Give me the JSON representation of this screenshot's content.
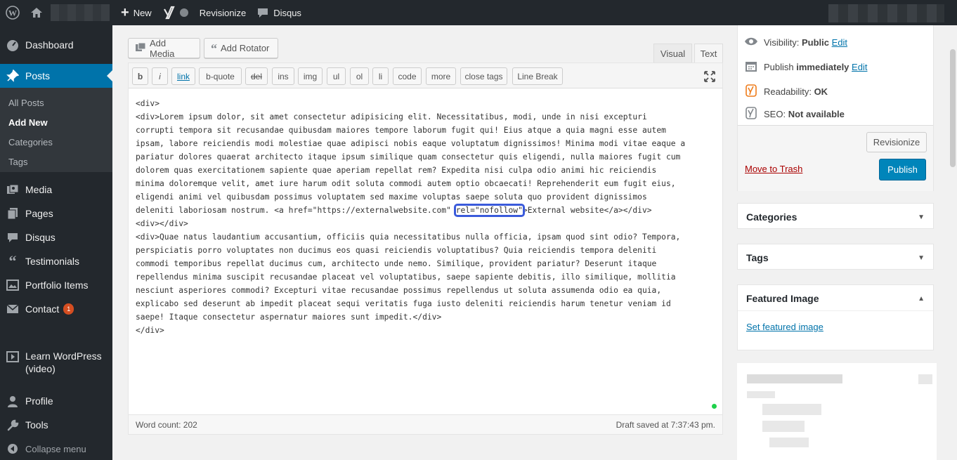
{
  "adminbar": {
    "new_label": "New",
    "revisionize_label": "Revisionize",
    "disqus_label": "Disqus"
  },
  "sidebar": {
    "dashboard": "Dashboard",
    "posts": "Posts",
    "submenu": [
      "All Posts",
      "Add New",
      "Categories",
      "Tags"
    ],
    "media": "Media",
    "pages": "Pages",
    "disqus": "Disqus",
    "testimonials": "Testimonials",
    "portfolio": "Portfolio Items",
    "contact": "Contact",
    "contact_badge": "1",
    "learn_line1": "Learn WordPress",
    "learn_line2": "(video)",
    "profile": "Profile",
    "tools": "Tools",
    "collapse": "Collapse menu"
  },
  "editor": {
    "add_media": "Add Media",
    "add_rotator": "Add Rotator",
    "tab_visual": "Visual",
    "tab_text": "Text",
    "quicktags": [
      "b",
      "i",
      "link",
      "b-quote",
      "del",
      "ins",
      "img",
      "ul",
      "ol",
      "li",
      "code",
      "more",
      "close tags",
      "Line Break"
    ],
    "code": {
      "l1": "<div>",
      "l2": "<div>Lorem ipsum dolor, sit amet consectetur adipisicing elit. Necessitatibus, modi, unde in nisi excepturi",
      "l3": "corrupti tempora sit recusandae quibusdam maiores tempore laborum fugit qui! Eius atque a quia magni esse autem",
      "l4": "ipsam, labore reiciendis modi molestiae quae adipisci nobis eaque voluptatum dignissimos! Minima modi vitae eaque a",
      "l5": "pariatur dolores quaerat architecto itaque ipsum similique quam consectetur quis eligendi, nulla maiores fugit cum",
      "l6": "dolorem quas exercitationem sapiente quae aperiam repellat rem? Expedita nisi culpa odio animi hic reiciendis",
      "l7": "minima doloremque velit, amet iure harum odit soluta commodi autem optio obcaecati! Reprehenderit eum fugit eius,",
      "l8": "eligendi animi vel quibusdam possimus voluptatem sed maxime voluptas saepe soluta quo provident dignissimos",
      "l9a": "deleniti laboriosam nostrum. <a href=\"https://externalwebsite.com\" ",
      "l9b": "rel=\"nofollow\"",
      "l9c": ">External website</a></div>",
      "l10": "<div></div>",
      "l11": "<div>Quae natus laudantium accusantium, officiis quia necessitatibus nulla officia, ipsam quod sint odio? Tempora,",
      "l12": "perspiciatis porro voluptates non ducimus eos quasi reiciendis voluptatibus? Quia reiciendis tempora deleniti",
      "l13": "commodi temporibus repellat ducimus cum, architecto unde nemo. Similique, provident pariatur? Deserunt itaque",
      "l14": "repellendus minima suscipit recusandae placeat vel voluptatibus, saepe sapiente debitis, illo similique, mollitia",
      "l15": "nesciunt asperiores commodi? Excepturi vitae recusandae possimus repellendus ut soluta assumenda odio ea quia,",
      "l16": "explicabo sed deserunt ab impedit placeat sequi veritatis fuga iusto deleniti reiciendis harum tenetur veniam id",
      "l17": "saepe! Itaque consectetur aspernatur maiores sunt impedit.</div>",
      "l18": "</div>"
    },
    "word_count": "Word count: 202",
    "draft_saved": "Draft saved at 7:37:43 pm."
  },
  "publish": {
    "visibility_label": "Visibility:",
    "visibility_value": "Public",
    "edit": "Edit",
    "publish_label": "Publish",
    "publish_value": "immediately",
    "readability_label": "Readability:",
    "readability_value": "OK",
    "seo_label": "SEO:",
    "seo_value": "Not available",
    "revisionize_button": "Revisionize",
    "trash": "Move to Trash",
    "publish_button": "Publish"
  },
  "boxes": {
    "categories": "Categories",
    "tags": "Tags",
    "featured_image": "Featured Image",
    "set_featured": "Set featured image"
  },
  "colors": {
    "adminbar": "#23282d",
    "accent": "#0073aa",
    "publish_button": "#0085ba",
    "highlight_box": "#3b5bdb",
    "badge": "#d54e21"
  }
}
